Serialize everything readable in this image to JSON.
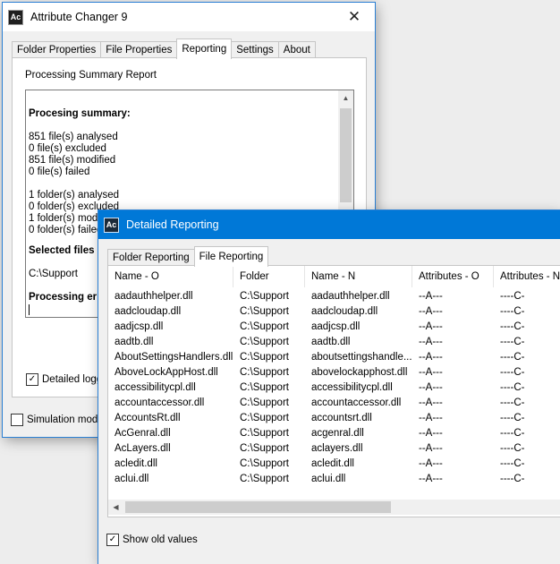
{
  "main_window": {
    "title": "Attribute Changer 9",
    "icon_text": "Ac",
    "close_glyph": "✕",
    "tabs": [
      {
        "label": "Folder Properties"
      },
      {
        "label": "File Properties"
      },
      {
        "label": "Reporting",
        "selected": true
      },
      {
        "label": "Settings"
      },
      {
        "label": "About"
      }
    ],
    "section_title": "Processing Summary Report",
    "report_lines": [
      {
        "text": "Procesing summary:",
        "bold": true
      },
      {
        "text": "851 file(s) analysed"
      },
      {
        "text": "0 file(s) excluded"
      },
      {
        "text": "851 file(s) modified"
      },
      {
        "text": "0 file(s) failed"
      },
      {
        "text": "1 folder(s) analysed"
      },
      {
        "text": "0 folder(s) excluded"
      },
      {
        "text": "1 folder(s) modified"
      },
      {
        "text": "0 folder(s) failed"
      },
      {
        "text": "Selected files",
        "bold": true
      },
      {
        "text": "C:\\Support"
      },
      {
        "text": "Processing er",
        "bold": true
      }
    ],
    "detailed_logging_label": "Detailed loggi",
    "detailed_logging_checked": true,
    "simulation_mode_label": "Simulation mode",
    "simulation_mode_checked": false
  },
  "detail_window": {
    "title": "Detailed Reporting",
    "icon_text": "Ac",
    "tabs": [
      {
        "label": "Folder Reporting"
      },
      {
        "label": "File Reporting",
        "selected": true
      }
    ],
    "columns": [
      "Name - O",
      "Folder",
      "Name - N",
      "Attributes - O",
      "Attributes - N"
    ],
    "rows": [
      [
        "aadauthhelper.dll",
        "C:\\Support",
        "aadauthhelper.dll",
        "--A---",
        "----C-"
      ],
      [
        "aadcloudap.dll",
        "C:\\Support",
        "aadcloudap.dll",
        "--A---",
        "----C-"
      ],
      [
        "aadjcsp.dll",
        "C:\\Support",
        "aadjcsp.dll",
        "--A---",
        "----C-"
      ],
      [
        "aadtb.dll",
        "C:\\Support",
        "aadtb.dll",
        "--A---",
        "----C-"
      ],
      [
        "AboutSettingsHandlers.dll",
        "C:\\Support",
        "aboutsettingshandle...",
        "--A---",
        "----C-"
      ],
      [
        "AboveLockAppHost.dll",
        "C:\\Support",
        "abovelockapphost.dll",
        "--A---",
        "----C-"
      ],
      [
        "accessibilitycpl.dll",
        "C:\\Support",
        "accessibilitycpl.dll",
        "--A---",
        "----C-"
      ],
      [
        "accountaccessor.dll",
        "C:\\Support",
        "accountaccessor.dll",
        "--A---",
        "----C-"
      ],
      [
        "AccountsRt.dll",
        "C:\\Support",
        "accountsrt.dll",
        "--A---",
        "----C-"
      ],
      [
        "AcGenral.dll",
        "C:\\Support",
        "acgenral.dll",
        "--A---",
        "----C-"
      ],
      [
        "AcLayers.dll",
        "C:\\Support",
        "aclayers.dll",
        "--A---",
        "----C-"
      ],
      [
        "acledit.dll",
        "C:\\Support",
        "acledit.dll",
        "--A---",
        "----C-"
      ],
      [
        "aclui.dll",
        "C:\\Support",
        "aclui.dll",
        "--A---",
        "----C-"
      ]
    ],
    "show_old_values_label": "Show old values",
    "show_old_values_checked": true
  }
}
